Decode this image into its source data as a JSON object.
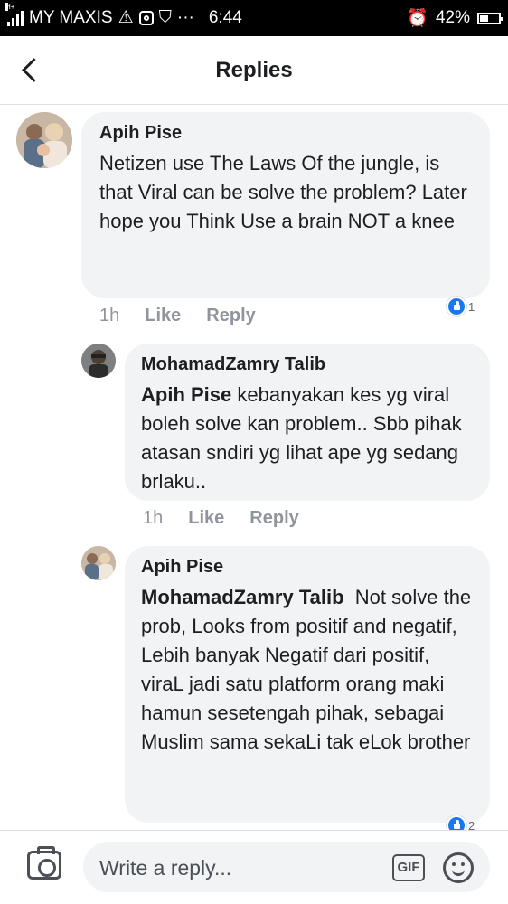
{
  "status_bar": {
    "network_tag": "H+",
    "carrier": "MY MAXIS",
    "time": "6:44",
    "battery": "42%"
  },
  "header": {
    "title": "Replies"
  },
  "comments": [
    {
      "author": "Apih Pise",
      "mention": "",
      "text": "Netizen use The Laws Of the jungle, is that Viral can be solve the problem? Later hope you Think Use a brain NOT a knee",
      "time": "1h",
      "like_label": "Like",
      "reply_label": "Reply",
      "reaction_count": "1"
    },
    {
      "author": "MohamadZamry Talib",
      "mention": "Apih Pise",
      "text": "kebanyakan kes yg viral boleh solve kan problem.. Sbb pihak atasan sndiri yg lihat ape yg sedang brlaku..",
      "time": "1h",
      "like_label": "Like",
      "reply_label": "Reply"
    },
    {
      "author": "Apih Pise",
      "mention": "MohamadZamry Talib",
      "text": "Not solve the prob, Looks from positif and negatif, Lebih banyak Negatif dari positif, viraL jadi satu platform orang maki hamun sesetengah pihak, sebagai Muslim sama sekaLi tak eLok brother",
      "reaction_count": "2"
    }
  ],
  "composer": {
    "placeholder": "Write a reply...",
    "gif_label": "GIF"
  },
  "icons": [
    "signal-icon",
    "warning-icon",
    "instagram-icon",
    "shield-icon",
    "more-icon",
    "alarm-icon",
    "battery-icon",
    "back-icon",
    "like-icon",
    "camera-icon",
    "emoji-icon"
  ]
}
